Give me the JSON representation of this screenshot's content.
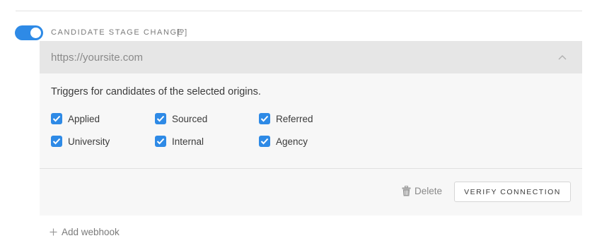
{
  "section": {
    "title": "CANDIDATE STAGE CHANGE",
    "help": "[?]",
    "toggle_on": true
  },
  "webhook": {
    "url_placeholder": "https://yoursite.com",
    "url_value": "",
    "description": "Triggers for candidates of the selected origins.",
    "origins": [
      {
        "label": "Applied",
        "checked": true
      },
      {
        "label": "Sourced",
        "checked": true
      },
      {
        "label": "Referred",
        "checked": true
      },
      {
        "label": "University",
        "checked": true
      },
      {
        "label": "Internal",
        "checked": true
      },
      {
        "label": "Agency",
        "checked": true
      }
    ],
    "delete_label": "Delete",
    "verify_label": "VERIFY CONNECTION"
  },
  "add_webhook_label": "Add webhook",
  "colors": {
    "accent": "#2e8ae6",
    "card_bg": "#f7f7f7",
    "url_bar_bg": "#e6e6e6"
  }
}
